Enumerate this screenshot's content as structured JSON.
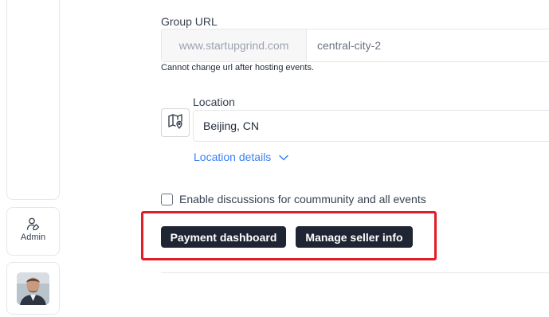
{
  "sidebar": {
    "admin_label": "Admin",
    "admin_icon": "user-edit-icon",
    "avatar_icon": "user-avatar"
  },
  "group_url": {
    "label": "Group URL",
    "prefix": "www.startupgrind.com",
    "slug": "central-city-2",
    "help": "Cannot change url after hosting events."
  },
  "location": {
    "label": "Location",
    "value": "Beijing, CN",
    "details_label": "Location details",
    "map_icon": "map-pin-icon"
  },
  "discussion": {
    "label": "Enable discussions for coummunity and all events",
    "checked": false
  },
  "actions": {
    "payment_dashboard": "Payment dashboard",
    "manage_seller_info": "Manage seller info"
  },
  "colors": {
    "primary_button": "#1f2533",
    "link": "#3b82f6",
    "highlight": "#e11d2a"
  }
}
